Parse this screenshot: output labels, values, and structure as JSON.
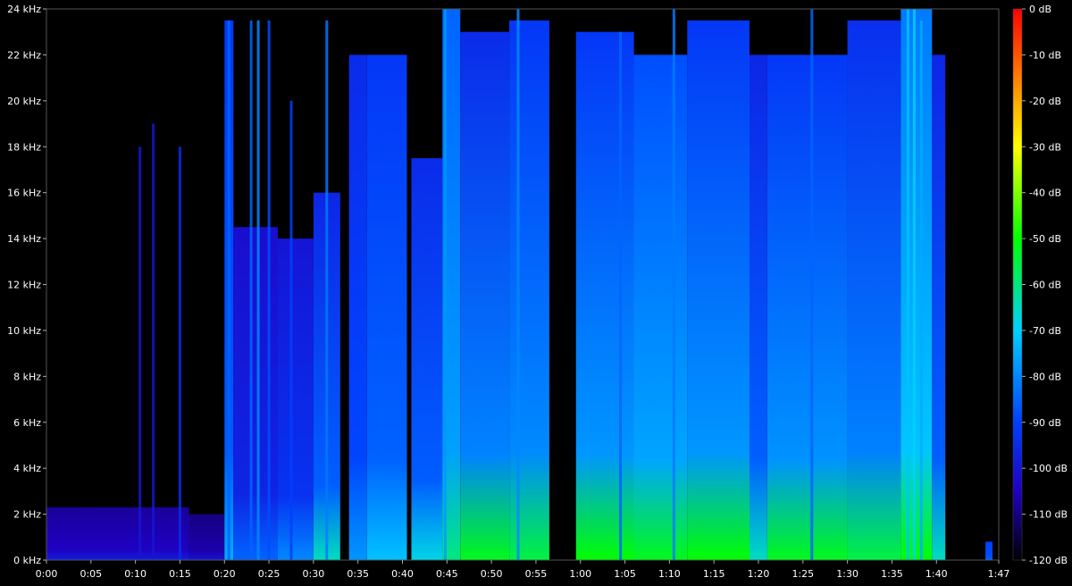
{
  "chart_data": {
    "type": "heatmap",
    "title": "",
    "xlabel": "",
    "ylabel": "",
    "x_unit": "time (m:ss)",
    "y_unit": "kHz",
    "xlim": [
      0,
      107
    ],
    "ylim": [
      0,
      24
    ],
    "colorbar_lim": [
      -120,
      0
    ],
    "x_ticks": [
      {
        "t": 0,
        "label": "0:00"
      },
      {
        "t": 5,
        "label": "0:05"
      },
      {
        "t": 10,
        "label": "0:10"
      },
      {
        "t": 15,
        "label": "0:15"
      },
      {
        "t": 20,
        "label": "0:20"
      },
      {
        "t": 25,
        "label": "0:25"
      },
      {
        "t": 30,
        "label": "0:30"
      },
      {
        "t": 35,
        "label": "0:35"
      },
      {
        "t": 40,
        "label": "0:40"
      },
      {
        "t": 45,
        "label": "0:45"
      },
      {
        "t": 50,
        "label": "0:50"
      },
      {
        "t": 55,
        "label": "0:55"
      },
      {
        "t": 60,
        "label": "1:00"
      },
      {
        "t": 65,
        "label": "1:05"
      },
      {
        "t": 70,
        "label": "1:10"
      },
      {
        "t": 75,
        "label": "1:15"
      },
      {
        "t": 80,
        "label": "1:20"
      },
      {
        "t": 85,
        "label": "1:25"
      },
      {
        "t": 90,
        "label": "1:30"
      },
      {
        "t": 95,
        "label": "1:35"
      },
      {
        "t": 100,
        "label": "1:40"
      },
      {
        "t": 107,
        "label": "1:47"
      }
    ],
    "y_ticks": [
      {
        "f": 0,
        "label": "0 kHz"
      },
      {
        "f": 2,
        "label": "2 kHz"
      },
      {
        "f": 4,
        "label": "4 kHz"
      },
      {
        "f": 6,
        "label": "6 kHz"
      },
      {
        "f": 8,
        "label": "8 kHz"
      },
      {
        "f": 10,
        "label": "10 kHz"
      },
      {
        "f": 12,
        "label": "12 kHz"
      },
      {
        "f": 14,
        "label": "14 kHz"
      },
      {
        "f": 16,
        "label": "16 kHz"
      },
      {
        "f": 18,
        "label": "18 kHz"
      },
      {
        "f": 20,
        "label": "20 kHz"
      },
      {
        "f": 22,
        "label": "22 kHz"
      },
      {
        "f": 24,
        "label": "24 kHz"
      }
    ],
    "colorbar_ticks": [
      {
        "db": 0,
        "label": "0 dB"
      },
      {
        "db": -10,
        "label": "-10 dB"
      },
      {
        "db": -20,
        "label": "-20 dB"
      },
      {
        "db": -30,
        "label": "-30 dB"
      },
      {
        "db": -40,
        "label": "-40 dB"
      },
      {
        "db": -50,
        "label": "-50 dB"
      },
      {
        "db": -60,
        "label": "-60 dB"
      },
      {
        "db": -70,
        "label": "-70 dB"
      },
      {
        "db": -80,
        "label": "-80 dB"
      },
      {
        "db": -90,
        "label": "-90 dB"
      },
      {
        "db": -100,
        "label": "-100 dB"
      },
      {
        "db": -110,
        "label": "-110 dB"
      },
      {
        "db": -120,
        "label": "-120 dB"
      }
    ],
    "colormap": [
      {
        "db": 0,
        "color": "#ff0000"
      },
      {
        "db": -15,
        "color": "#ff8000"
      },
      {
        "db": -30,
        "color": "#ffff00"
      },
      {
        "db": -50,
        "color": "#00ff00"
      },
      {
        "db": -70,
        "color": "#00d0ff"
      },
      {
        "db": -90,
        "color": "#0040ff"
      },
      {
        "db": -105,
        "color": "#2000c0"
      },
      {
        "db": -120,
        "color": "#000000"
      }
    ],
    "segments": [
      {
        "start": 0,
        "end": 16,
        "maxf": 2.3,
        "db": -108,
        "low_db": -98
      },
      {
        "start": 16,
        "end": 20,
        "maxf": 2.0,
        "db": -110,
        "low_db": -100
      },
      {
        "start": 20,
        "end": 21,
        "maxf": 23.5,
        "db": -92,
        "low_db": -75
      },
      {
        "start": 21,
        "end": 26,
        "maxf": 14.5,
        "db": -102,
        "low_db": -85
      },
      {
        "start": 26,
        "end": 30,
        "maxf": 14.0,
        "db": -100,
        "low_db": -80
      },
      {
        "start": 30,
        "end": 33,
        "maxf": 16.0,
        "db": -96,
        "low_db": -65
      },
      {
        "start": 34,
        "end": 36,
        "maxf": 22.0,
        "db": -95,
        "low_db": -78
      },
      {
        "start": 36,
        "end": 40.5,
        "maxf": 22.0,
        "db": -92,
        "low_db": -72
      },
      {
        "start": 41,
        "end": 44.5,
        "maxf": 17.5,
        "db": -95,
        "low_db": -68
      },
      {
        "start": 44.5,
        "end": 46.5,
        "maxf": 24.0,
        "db": -85,
        "low_db": -60
      },
      {
        "start": 46.5,
        "end": 52,
        "maxf": 23.0,
        "db": -95,
        "low_db": -52
      },
      {
        "start": 52,
        "end": 56.5,
        "maxf": 23.5,
        "db": -92,
        "low_db": -55
      },
      {
        "start": 59.5,
        "end": 66,
        "maxf": 23.0,
        "db": -92,
        "low_db": -50
      },
      {
        "start": 66,
        "end": 72,
        "maxf": 22.0,
        "db": -88,
        "low_db": -52
      },
      {
        "start": 72,
        "end": 79,
        "maxf": 23.5,
        "db": -92,
        "low_db": -50
      },
      {
        "start": 79,
        "end": 81,
        "maxf": 22.0,
        "db": -96,
        "low_db": -65
      },
      {
        "start": 81,
        "end": 90,
        "maxf": 22.0,
        "db": -92,
        "low_db": -52
      },
      {
        "start": 90,
        "end": 96,
        "maxf": 23.5,
        "db": -94,
        "low_db": -55
      },
      {
        "start": 96,
        "end": 99.5,
        "maxf": 24.0,
        "db": -82,
        "low_db": -50
      },
      {
        "start": 99.5,
        "end": 101,
        "maxf": 22.0,
        "db": -96,
        "low_db": -65
      },
      {
        "start": 105.5,
        "end": 106.3,
        "maxf": 0.8,
        "db": -90,
        "low_db": -85
      }
    ],
    "streaks": [
      {
        "t": 10.5,
        "maxf": 18,
        "db": -100
      },
      {
        "t": 12.0,
        "maxf": 19,
        "db": -100
      },
      {
        "t": 15.0,
        "maxf": 18,
        "db": -95
      },
      {
        "t": 20.5,
        "maxf": 23.5,
        "db": -85
      },
      {
        "t": 23.0,
        "maxf": 23.5,
        "db": -85
      },
      {
        "t": 23.8,
        "maxf": 23.5,
        "db": -80
      },
      {
        "t": 25.0,
        "maxf": 23.5,
        "db": -88
      },
      {
        "t": 27.5,
        "maxf": 20,
        "db": -90
      },
      {
        "t": 31.5,
        "maxf": 23.5,
        "db": -82
      },
      {
        "t": 44.8,
        "maxf": 24,
        "db": -78
      },
      {
        "t": 53.0,
        "maxf": 24,
        "db": -80
      },
      {
        "t": 64.5,
        "maxf": 23,
        "db": -85
      },
      {
        "t": 70.5,
        "maxf": 24,
        "db": -82
      },
      {
        "t": 86.0,
        "maxf": 24,
        "db": -85
      },
      {
        "t": 96.8,
        "maxf": 24,
        "db": -72
      },
      {
        "t": 97.5,
        "maxf": 24,
        "db": -70
      },
      {
        "t": 98.3,
        "maxf": 23.5,
        "db": -75
      }
    ]
  }
}
